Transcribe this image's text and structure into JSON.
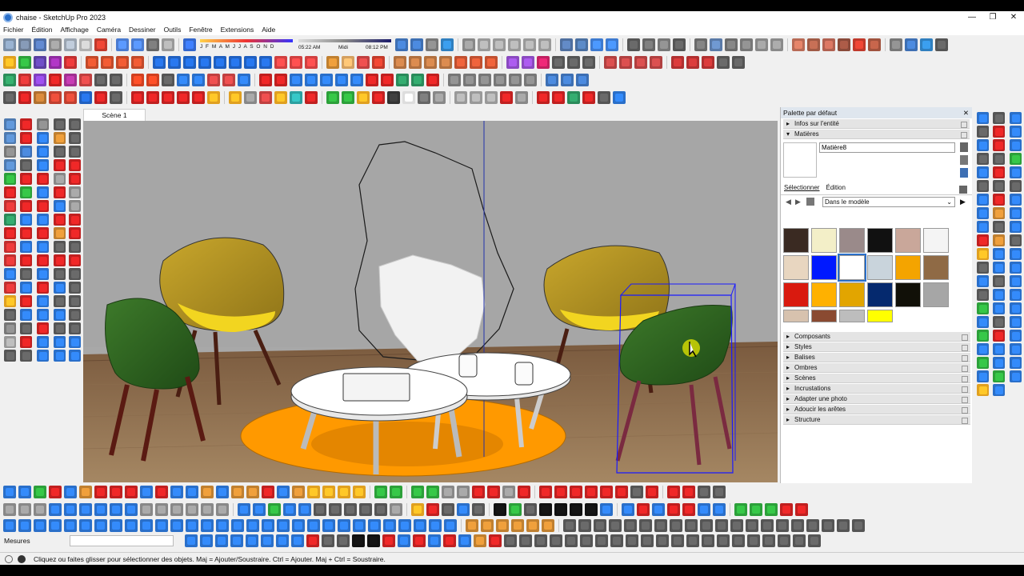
{
  "window": {
    "title": "chaise - SketchUp Pro 2023",
    "controls": [
      "—",
      "❐",
      "✕"
    ]
  },
  "menu": [
    "Fichier",
    "Édition",
    "Affichage",
    "Caméra",
    "Dessiner",
    "Outils",
    "Fenêtre",
    "Extensions",
    "Aide"
  ],
  "shadow": {
    "months": "J F M A M J J A S O N D",
    "time_start": "05:22 AM",
    "time_mid": "Midi",
    "time_end": "08:12 PM"
  },
  "scene_tab": "Scène 1",
  "panel": {
    "title": "Palette par défaut",
    "sections_top": [
      "Infos sur l'entité",
      "Matières"
    ],
    "material_name": "Matière8",
    "tabs": [
      "Sélectionner",
      "Édition"
    ],
    "collection": "Dans le modèle",
    "swatches": [
      "#3a2a22",
      "#f3efc8",
      "#9a8a8a",
      "#111111",
      "#c9a79a",
      "#f4f4f4",
      "#e8d6c0",
      "#0019ff",
      "#ffffff",
      "#c9d4dc",
      "#f4a400",
      "#8f6a45",
      "#d91a0f",
      "#ffb100",
      "#e2a500",
      "#05296e",
      "#111008",
      "#a6a6a6",
      "#d7c2ae",
      "#8a4a31",
      "#bdbdbd",
      "#ffff00"
    ],
    "sections_bottom": [
      "Composants",
      "Styles",
      "Balises",
      "Ombres",
      "Scènes",
      "Incrustations",
      "Adapter une photo",
      "Adoucir les arêtes",
      "Structure"
    ]
  },
  "measurements_label": "Mesures",
  "status": "Cliquez ou faites glisser pour sélectionner des objets. Maj = Ajouter/Soustraire. Ctrl = Ajouter. Maj + Ctrl = Soustraire.",
  "colors": {
    "accent": "#2a6fc9",
    "selection": "#1a1aff",
    "rug": "#ff9900",
    "wall": "#a8a8a8"
  }
}
